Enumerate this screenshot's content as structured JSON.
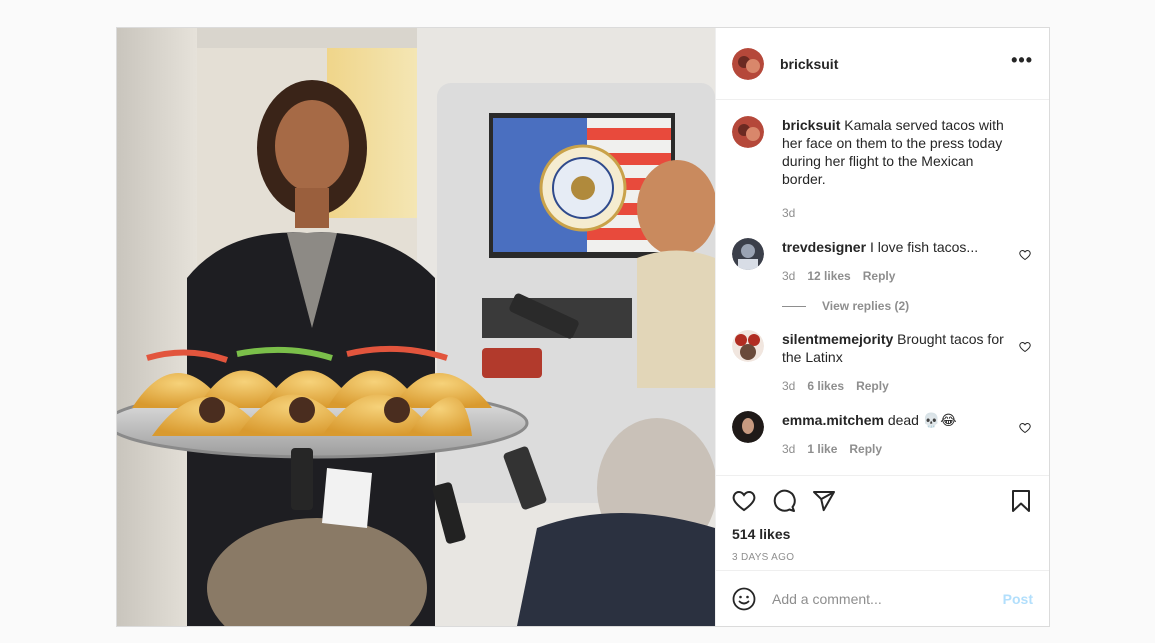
{
  "post": {
    "username": "bricksuit",
    "more_icon": "ellipsis-icon",
    "image_alt": "edited photo of Kamala Harris holding a tray of tacos printed with her face aboard Air Force Two, reporters holding recorders",
    "caption": {
      "username": "bricksuit",
      "text": "Kamala served tacos with her face on them to the press today during her flight to the Mexican border.",
      "time": "3d"
    },
    "comments": [
      {
        "username": "trevdesigner",
        "text": "I love fish tacos...",
        "time": "3d",
        "likes": "12 likes",
        "reply": "Reply",
        "view_replies": "View replies (2)"
      },
      {
        "username": "silentmemejority",
        "text": "Brought tacos for the Latinx",
        "time": "3d",
        "likes": "6 likes",
        "reply": "Reply"
      },
      {
        "username": "emma.mitchem",
        "text": "dead 💀😂",
        "time": "3d",
        "likes": "1 like",
        "reply": "Reply"
      }
    ],
    "likes_count": "514 likes",
    "time_ago": "3 DAYS AGO",
    "add_comment_placeholder": "Add a comment...",
    "post_button": "Post"
  },
  "colors": {
    "text": "#262626",
    "secondary": "#8e8e8e",
    "post_button_disabled": "#b2dffc",
    "border": "#dbdbdb"
  }
}
